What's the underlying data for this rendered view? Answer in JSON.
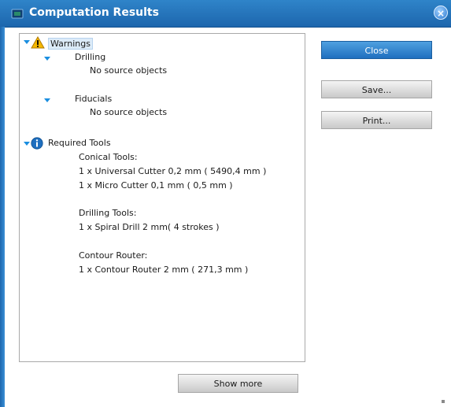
{
  "window": {
    "title": "Computation Results",
    "close_glyph": "×"
  },
  "tree": {
    "warnings_label": "Warnings",
    "drilling_label": "Drilling",
    "drilling_detail": "No source objects",
    "fiducials_label": "Fiducials",
    "fiducials_detail": "No source objects",
    "required_tools_label": "Required Tools",
    "conical_header": "Conical Tools:",
    "conical_items": [
      "1 x Universal Cutter 0,2 mm ( 5490,4 mm )",
      "1 x Micro Cutter 0,1 mm ( 0,5 mm )"
    ],
    "drilling_tools_header": "Drilling Tools:",
    "drilling_tools_items": [
      "1 x Spiral Drill  2 mm( 4 strokes )"
    ],
    "contour_header": "Contour Router:",
    "contour_items": [
      "1 x Contour Router 2 mm ( 271,3 mm )"
    ]
  },
  "buttons": {
    "close": "Close",
    "save": "Save...",
    "print": "Print...",
    "show_more": "Show more"
  },
  "icons": {
    "app": "app-icon",
    "warning": "warning-icon",
    "info": "info-icon",
    "expand": "expand-triangle-icon"
  },
  "colors": {
    "titlebar": "#1d66ad",
    "primary_button": "#1f6fbf",
    "warning": "#f5b800",
    "info": "#1f6fbf"
  }
}
